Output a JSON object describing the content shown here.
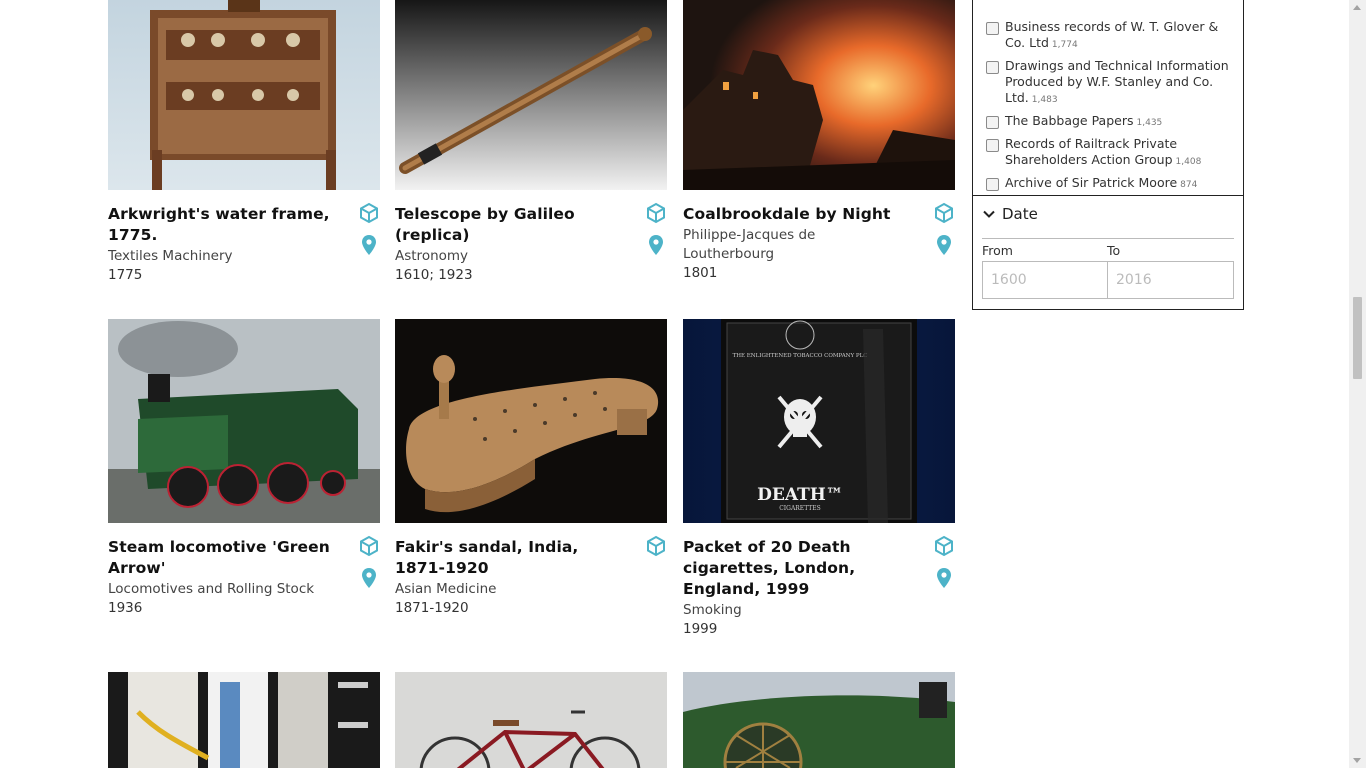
{
  "colors": {
    "accent": "#4db3c8",
    "border": "#222222"
  },
  "results": [
    {
      "title": "Arkwright's water frame, 1775.",
      "category": "Textiles Machinery",
      "date": "1775",
      "image": "water-frame-machine"
    },
    {
      "title": "Telescope by Galileo (replica)",
      "category": "Astronomy",
      "date": "1610; 1923",
      "image": "telescope"
    },
    {
      "title": "Coalbrookdale by Night",
      "category": "Philippe-Jacques de Loutherbourg",
      "date": "1801",
      "image": "painting-fire-night"
    },
    {
      "title": "Steam locomotive 'Green Arrow'",
      "category": "Locomotives and Rolling Stock",
      "date": "1936",
      "image": "green-steam-locomotive"
    },
    {
      "title": "Fakir's sandal, India, 1871-1920",
      "category": "Asian Medicine",
      "date": "1871-1920",
      "image": "spiked-sandal"
    },
    {
      "title": "Packet of 20 Death cigarettes, London, England, 1999",
      "category": "Smoking",
      "date": "1999",
      "image": "death-cigarettes-packet",
      "packet_brand": "DEATH™",
      "packet_sub": "CIGARETTES",
      "packet_company": "THE ENLIGHTENED TOBACCO COMPANY PLC"
    },
    {
      "image": "machinery-interior"
    },
    {
      "image": "red-bicycle"
    },
    {
      "image": "green-locomotive-closeup"
    }
  ],
  "filters": {
    "archive_items": [
      {
        "label": "Business records of W. T. Glover & Co. Ltd",
        "count": "1,774"
      },
      {
        "label": "Drawings and Technical Information Produced by W.F. Stanley and Co. Ltd.",
        "count": "1,483"
      },
      {
        "label": "The Babbage Papers",
        "count": "1,435"
      },
      {
        "label": "Records of Railtrack Private Shareholders Action Group",
        "count": "1,408"
      },
      {
        "label": "Archive of Sir Patrick Moore",
        "count": "874"
      }
    ],
    "date": {
      "heading": "Date",
      "from_label": "From",
      "to_label": "To",
      "from_placeholder": "1600",
      "to_placeholder": "2016"
    }
  },
  "icons": {
    "model": "cube-3d-icon",
    "location": "map-pin-icon"
  }
}
